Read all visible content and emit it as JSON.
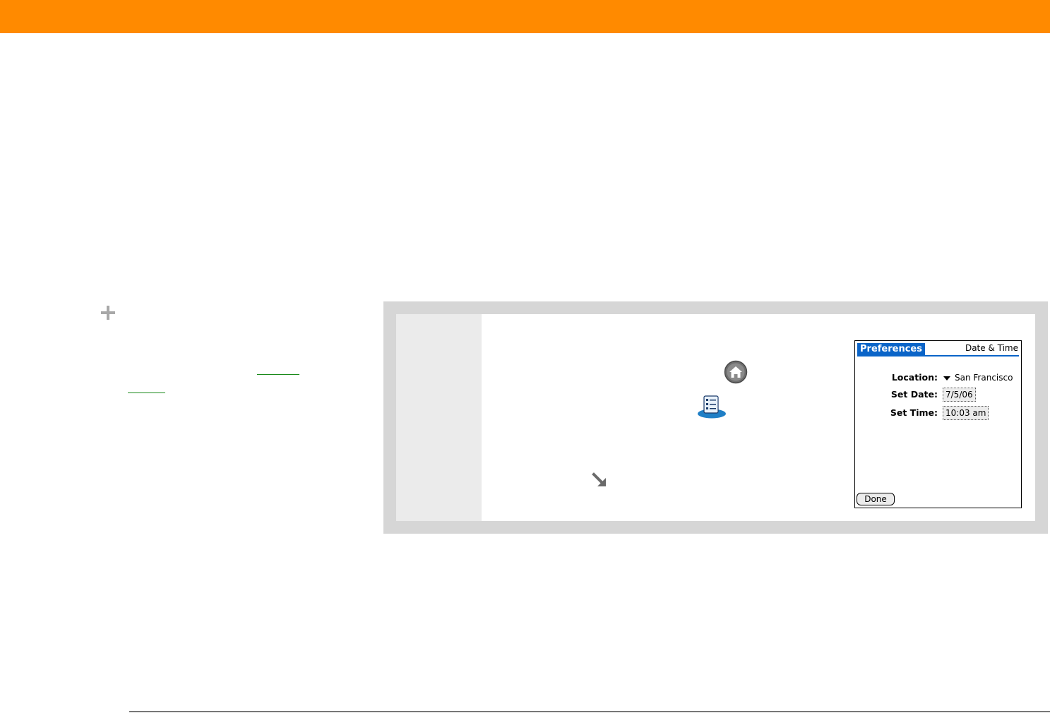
{
  "icons": {
    "tip": "plus-icon",
    "home": "home-icon",
    "preferences": "preferences-icon",
    "done": "done-arrow-icon"
  },
  "colors": {
    "header": "#ff8a00",
    "panel": "#d6d6d6",
    "palm_tab": "#0a64c8",
    "link": "#1a8a1a"
  },
  "palm": {
    "tab_label": "Preferences",
    "title": "Date & Time",
    "location_label": "Location:",
    "location_value": "San Francisco",
    "set_date_label": "Set Date:",
    "set_date_value": "7/5/06",
    "set_time_label": "Set Time:",
    "set_time_value": "10:03 am",
    "done_label": "Done"
  }
}
